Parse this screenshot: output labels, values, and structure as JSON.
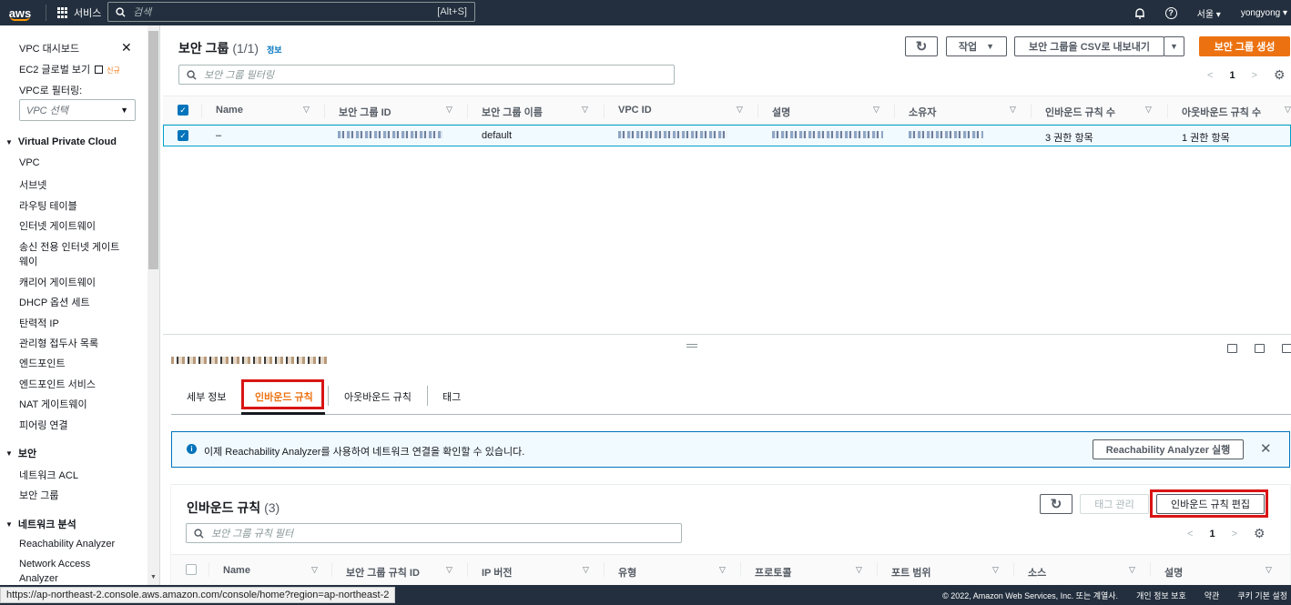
{
  "nav": {
    "logo": "aws",
    "services": "서비스",
    "search_placeholder": "검색",
    "search_shortcut": "[Alt+S]",
    "region": "서울 ▾",
    "user": "yongyong ▾",
    "help": "?"
  },
  "sidebar": {
    "dashboard": "VPC 대시보드",
    "global_view": "EC2 글로벌 보기",
    "global_view_badge": "신규",
    "filter_label": "VPC로 필터링:",
    "vpc_select": "VPC 선택",
    "section_vpc": "Virtual Private Cloud",
    "vpc_items": [
      "VPC",
      "서브넷",
      "라우팅 테이블",
      "인터넷 게이트웨이",
      "송신 전용 인터넷 게이트",
      "웨이",
      "캐리어 게이트웨이",
      "DHCP 옵션 세트",
      "탄력적 IP",
      "관리형 접두사 목록",
      "엔드포인트",
      "엔드포인트 서비스",
      "NAT 게이트웨이",
      "피어링 연결"
    ],
    "section_security": "보안",
    "security_items": [
      "네트워크 ACL",
      "보안 그룹"
    ],
    "section_analysis": "네트워크 분석",
    "analysis_items": [
      "Reachability Analyzer",
      "Network Access",
      "Analyzer"
    ]
  },
  "main": {
    "title": "보안 그룹",
    "count": "(1/1)",
    "info": "정보",
    "refresh": "↻",
    "actions": "작업",
    "export_csv": "보안 그룹을 CSV로 내보내기",
    "create": "보안 그룹 생성",
    "filter_placeholder": "보안 그룹 필터링",
    "page": "1",
    "columns": [
      "Name",
      "보안 그룹 ID",
      "보안 그룹 이름",
      "VPC ID",
      "설명",
      "소유자",
      "인바운드 규칙 수",
      "아웃바운드 규칙 수"
    ],
    "row": {
      "name": "–",
      "group_name": "default",
      "inbound_count": "3 권한 항목",
      "outbound_count": "1 권한 항목"
    }
  },
  "detail": {
    "tabs": [
      "세부 정보",
      "인바운드 규칙",
      "아웃바운드 규칙",
      "태그"
    ],
    "alert_text": "이제 Reachability Analyzer를 사용하여 네트워크 연결을 확인할 수 있습니다.",
    "alert_button": "Reachability Analyzer 실행",
    "inbound_title": "인바운드 규칙",
    "inbound_count": "(3)",
    "manage_tags": "태그 관리",
    "edit_inbound": "인바운드 규칙 편집",
    "rule_filter_placeholder": "보안 그룹 규칙 필터",
    "page": "1",
    "rule_columns": [
      "Name",
      "보안 그룹 규칙 ID",
      "IP 버전",
      "유형",
      "프로토콜",
      "포트 범위",
      "소스",
      "설명"
    ]
  },
  "footer": {
    "url": "https://ap-northeast-2.console.aws.amazon.com/console/home?region=ap-northeast-2",
    "copyright": "© 2022, Amazon Web Services, Inc. 또는 계열사.",
    "privacy": "개인 정보 보호",
    "terms": "약관",
    "cookies": "쿠키 기본 설정"
  },
  "colors": {
    "nav_bg": "#232f3e",
    "accent_orange": "#ec7211",
    "link_blue": "#0073bb",
    "highlight_red": "#d91515"
  }
}
